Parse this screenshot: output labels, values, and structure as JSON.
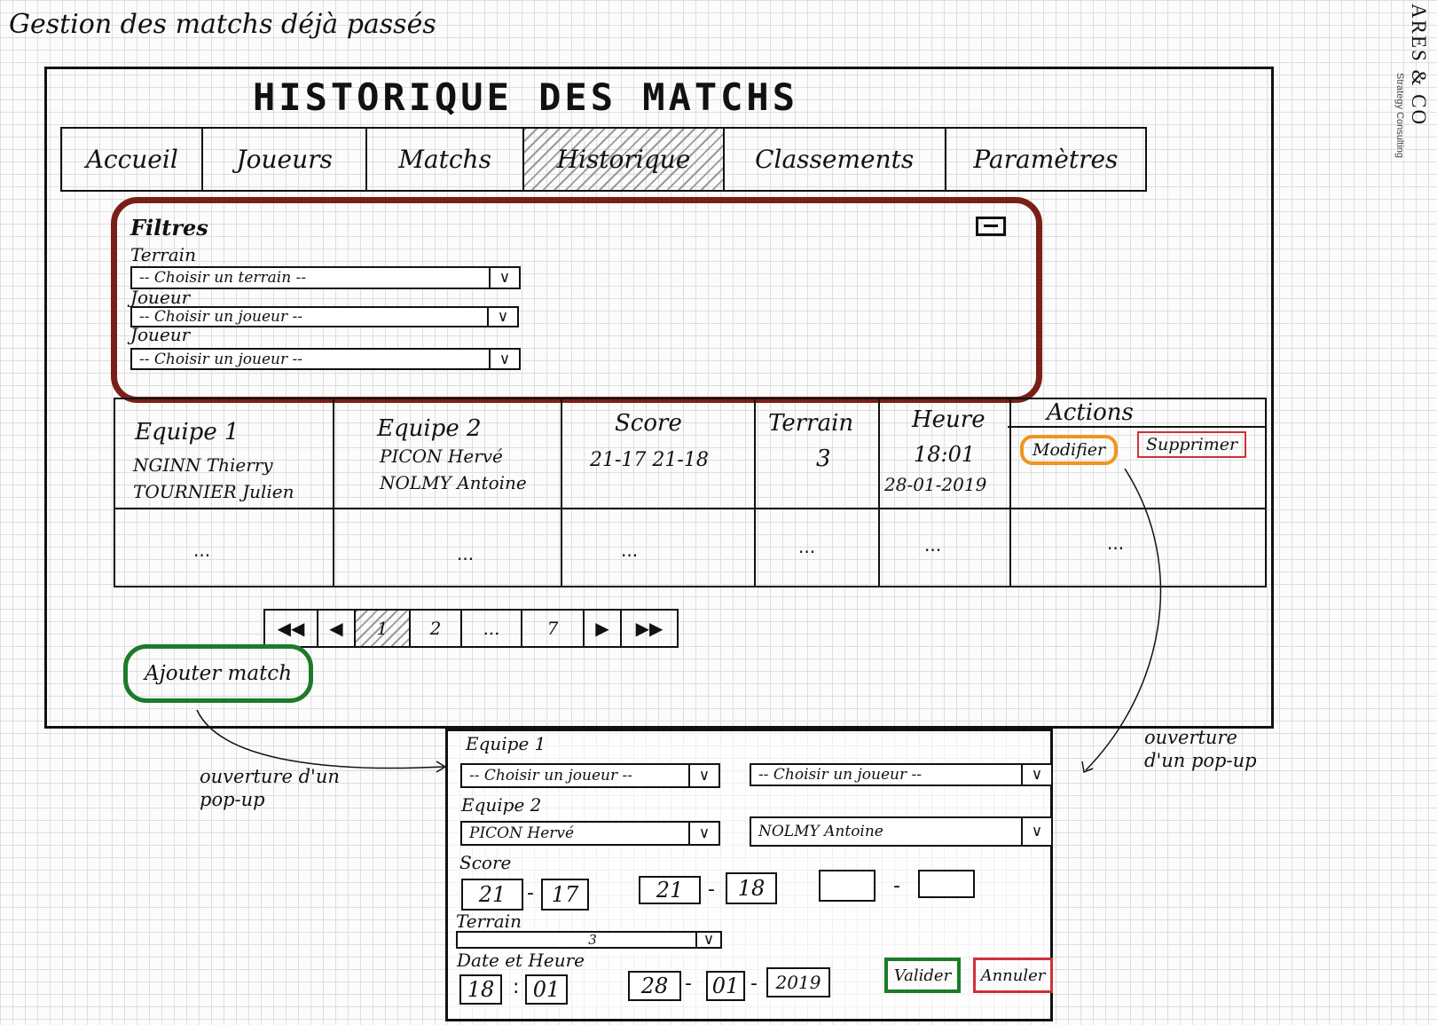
{
  "page": {
    "caption": "Gestion des matchs déjà passés",
    "brand_name": "ARES & CO",
    "brand_tagline": "Strategy Consulting"
  },
  "window": {
    "title": "HISTORIQUE DES MATCHS"
  },
  "tabs": [
    {
      "label": "Accueil"
    },
    {
      "label": "Joueurs"
    },
    {
      "label": "Matchs"
    },
    {
      "label": "Historique"
    },
    {
      "label": "Classements"
    },
    {
      "label": "Paramètres"
    }
  ],
  "active_tab": "Historique",
  "filters": {
    "title": "Filtres",
    "fields": [
      {
        "label": "Terrain",
        "value": "-- Choisir un terrain --"
      },
      {
        "label": "Joueur",
        "value": "-- Choisir un joueur --"
      },
      {
        "label": "Joueur",
        "value": "-- Choisir un joueur --"
      }
    ]
  },
  "table": {
    "headers": [
      "Equipe 1",
      "Equipe 2",
      "Score",
      "Terrain",
      "Heure",
      "Actions"
    ],
    "rows": [
      {
        "team1": [
          "NGINN Thierry",
          "TOURNIER Julien"
        ],
        "team2": [
          "PICON Hervé",
          "NOLMY Antoine"
        ],
        "score": "21-17  21-18",
        "terrain": "3",
        "heure": "18:01",
        "date": "28-01-2019",
        "actions": {
          "modify": "Modifier",
          "delete": "Supprimer"
        }
      },
      {
        "team1_placeholder": "...",
        "team2_placeholder": "...",
        "score_placeholder": "...",
        "terrain_placeholder": "...",
        "heure_placeholder": "...",
        "actions_placeholder": "..."
      }
    ]
  },
  "pagination": {
    "pages": [
      "1",
      "2",
      "...",
      "7"
    ],
    "current": "1"
  },
  "add_match_label": "Ajouter match",
  "notes": {
    "left": "ouverture d'un pop-up",
    "right": "ouverture d'un pop-up"
  },
  "popup": {
    "team1_label": "Equipe 1",
    "team1_player1": "-- Choisir un joueur --",
    "team1_player2": "-- Choisir un joueur --",
    "team2_label": "Equipe 2",
    "team2_player1": "PICON Hervé",
    "team2_player2": "NOLMY Antoine",
    "score_label": "Score",
    "sets": [
      {
        "a": "21",
        "b": "17"
      },
      {
        "a": "21",
        "b": "18"
      },
      {
        "a": "",
        "b": ""
      }
    ],
    "terrain_label": "Terrain",
    "terrain_value": "3",
    "datetime_label": "Date et Heure",
    "hour": "18",
    "minute": "01",
    "day": "28",
    "month": "01",
    "year": "2019",
    "validate_label": "Valider",
    "cancel_label": "Annuler"
  },
  "colors": {
    "filter_border": "#7a1f17",
    "modify_border": "#f0951e",
    "delete_border": "#d0303a",
    "add_border": "#1e7a2a",
    "validate_border": "#1e7a2a",
    "cancel_border": "#d0303a"
  }
}
